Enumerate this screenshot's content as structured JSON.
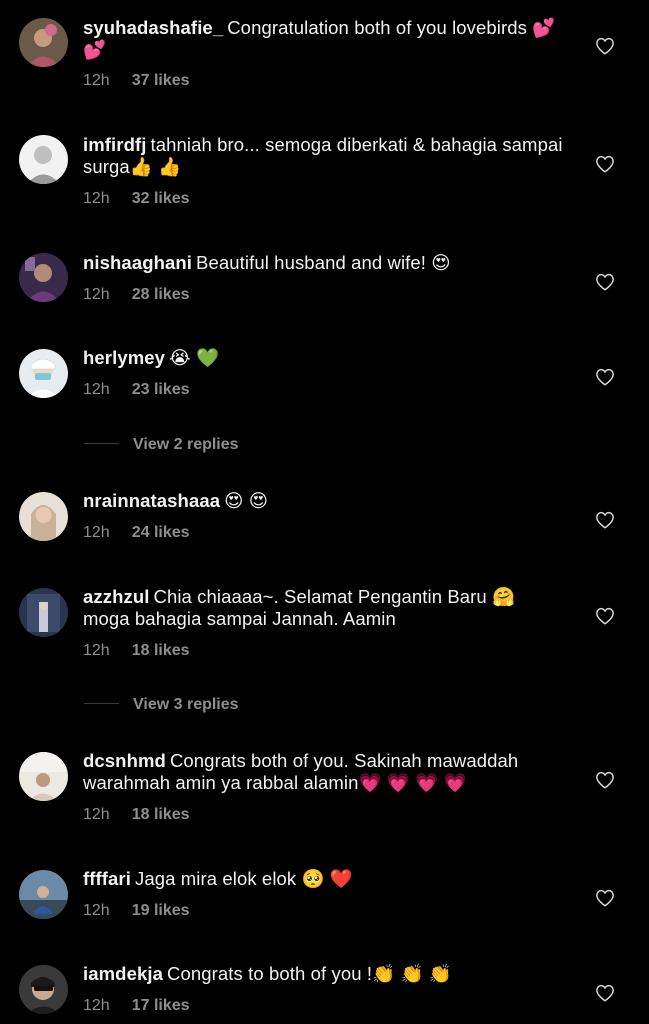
{
  "comments": [
    {
      "username": "syuhadashafie_",
      "text": "Congratulation both of you lovebirds 💕 💕",
      "time": "12h",
      "likes": "37 likes",
      "avatar_color": "#6b5a4a"
    },
    {
      "username": "imfirdfj",
      "text": "tahniah bro... semoga diberkati & bahagia sampai surga👍 👍",
      "time": "12h",
      "likes": "32 likes",
      "avatar_color": "#d9d9d9"
    },
    {
      "username": "nishaaghani",
      "text": "Beautiful husband and wife! 😍",
      "time": "12h",
      "likes": "28 likes",
      "avatar_color": "#5a3a6a"
    },
    {
      "username": "herlymey",
      "text": "😭 💚",
      "time": "12h",
      "likes": "23 likes",
      "avatar_color": "#d8e0e6"
    },
    {
      "username": "nrainnatashaaa",
      "text": "😍 😍",
      "time": "12h",
      "likes": "24 likes",
      "avatar_color": "#c9b8a6"
    },
    {
      "username": "azzhzul",
      "text": "Chia chiaaaa~. Selamat Pengantin Baru 🤗 moga bahagia sampai Jannah. Aamin",
      "time": "12h",
      "likes": "18 likes",
      "avatar_color": "#2f3a55"
    },
    {
      "username": "dcsnhmd",
      "text": "Congrats both of you. Sakinah mawaddah warahmah amin ya rabbal alamin💗 💗 💗 💗",
      "time": "12h",
      "likes": "18 likes",
      "avatar_color": "#e8e4de"
    },
    {
      "username": "ffffari",
      "text": "Jaga mira elok elok 🥺 ❤️",
      "time": "12h",
      "likes": "19 likes",
      "avatar_color": "#4a6a8a"
    },
    {
      "username": "iamdekja",
      "text": "Congrats to both of you !👏 👏 👏",
      "time": "12h",
      "likes": "17 likes",
      "avatar_color": "#2a2a2a"
    }
  ],
  "view_replies": [
    {
      "label": "View 2 replies"
    },
    {
      "label": "View 3 replies"
    }
  ],
  "colors": {
    "background": "#000000",
    "text": "#f2f2f2",
    "secondary": "#8e8e8e",
    "divider": "#3a3a3a"
  },
  "icons": {
    "like": "heart-outline-icon"
  }
}
